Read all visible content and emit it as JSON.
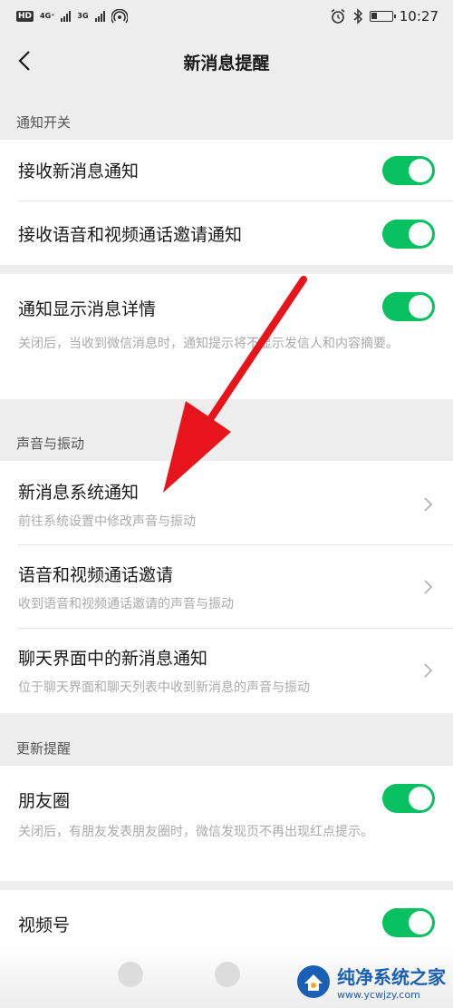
{
  "status_bar": {
    "hd": "HD",
    "sig1": "4G⁺",
    "sig2": "3G",
    "time": "10:27",
    "battery_level": 0.3
  },
  "nav": {
    "title": "新消息提醒"
  },
  "sections": {
    "notify_switch": "通知开关",
    "sound_vibration": "声音与振动",
    "update_remind": "更新提醒"
  },
  "rows": {
    "receive_new": {
      "title": "接收新消息通知",
      "on": true
    },
    "receive_call": {
      "title": "接收语音和视频通话邀请通知",
      "on": true
    },
    "show_detail": {
      "title": "通知显示消息详情",
      "desc": "关闭后，当收到微信消息时，通知提示将不显示发信人和内容摘要。",
      "on": true
    },
    "system_notify": {
      "title": "新消息系统通知",
      "desc": "前往系统设置中修改声音与振动"
    },
    "call_invite": {
      "title": "语音和视频通话邀请",
      "desc": "收到语音和视频通话邀请的声音与振动"
    },
    "chat_notify": {
      "title": "聊天界面中的新消息通知",
      "desc": "位于聊天界面和聊天列表中收到新消息的声音与振动"
    },
    "moments": {
      "title": "朋友圈",
      "desc": "关闭后，有朋友发表朋友圈时，微信发现页不再出现红点提示。",
      "on": true
    },
    "channels": {
      "title": "视频号",
      "on": true
    }
  },
  "watermark": {
    "title": "纯净系统之家",
    "url": "www.ycwjzy.com"
  },
  "colors": {
    "accent": "#07c160",
    "arrow": "#e8141c"
  }
}
